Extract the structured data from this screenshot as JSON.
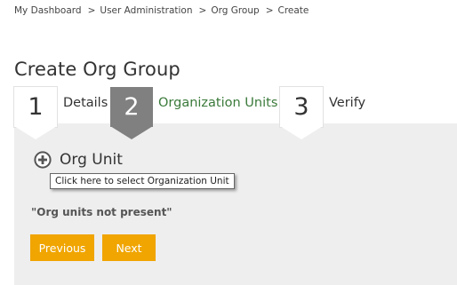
{
  "breadcrumb": {
    "items": [
      "My Dashboard",
      "User Administration",
      "Org Group",
      "Create"
    ],
    "separator": ">"
  },
  "page_title": "Create Org Group",
  "steps": [
    {
      "number": "1",
      "label": "Details",
      "state": "completed"
    },
    {
      "number": "2",
      "label": "Organization Units",
      "state": "active"
    },
    {
      "number": "3",
      "label": "Verify",
      "state": "pending"
    }
  ],
  "add_org_unit": {
    "label": "Org Unit",
    "icon": "plus-circle-icon",
    "tooltip": "Click here to select Organization Unit"
  },
  "empty_message": "\"Org units not present\"",
  "buttons": {
    "previous": "Previous",
    "next": "Next"
  },
  "colors": {
    "accent": "#f0a500",
    "active_step": "#808080",
    "active_label": "#3a7a3a",
    "panel": "#eeeeee"
  }
}
